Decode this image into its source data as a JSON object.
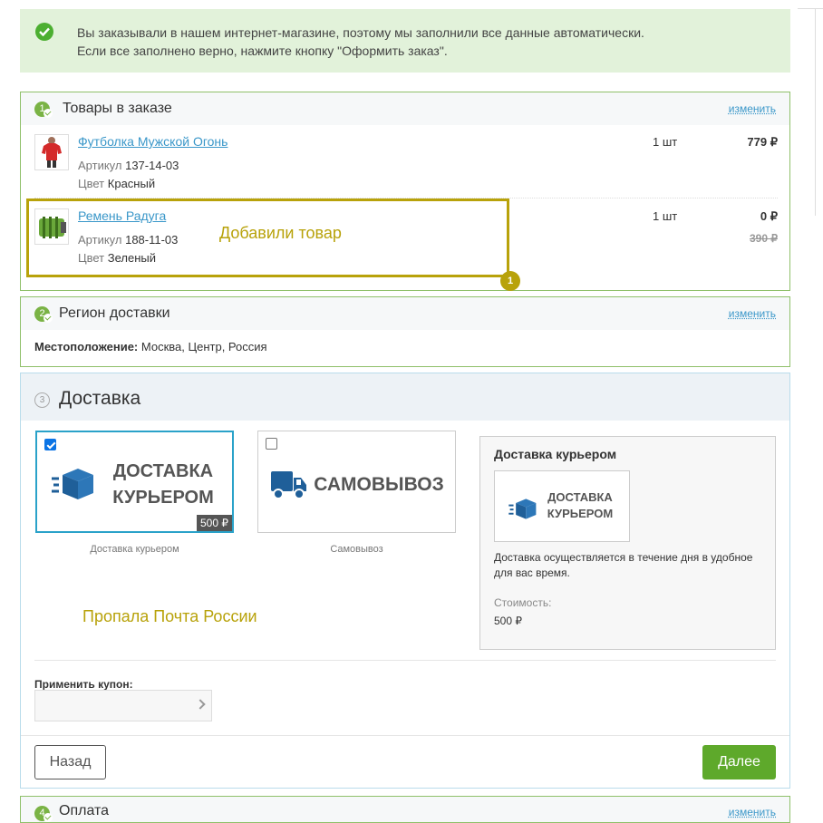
{
  "alert": {
    "line1": "Вы заказывали в нашем интернет-магазине, поэтому мы заполнили все данные автоматически.",
    "line2": "Если все заполнено верно, нажмите кнопку \"Оформить заказ\"."
  },
  "order": {
    "step": "1",
    "title": "Товары в заказе",
    "change": "изменить",
    "items": [
      {
        "name": "Футболка Мужской Огонь",
        "article_label": "Артикул",
        "article": "137-14-03",
        "color_label": "Цвет",
        "color": "Красный",
        "qty": "1 шт",
        "price": "779 ₽",
        "old_price": ""
      },
      {
        "name": "Ремень Радуга",
        "article_label": "Артикул",
        "article": "188-11-03",
        "color_label": "Цвет",
        "color": "Зеленый",
        "qty": "1 шт",
        "price": "0 ₽",
        "old_price": "390 ₽"
      }
    ]
  },
  "annotations": {
    "added": "Добавили товар",
    "badge": "1",
    "missing": "Пропала Почта России"
  },
  "region": {
    "step": "2",
    "title": "Регион доставки",
    "change": "изменить",
    "location_label": "Местоположение:",
    "location": "Москва, Центр, Россия"
  },
  "delivery": {
    "step": "3",
    "title": "Доставка",
    "options": [
      {
        "line1": "ДОСТАВКА",
        "line2": "КУРЬЕРОМ",
        "price": "500 ₽",
        "caption": "Доставка курьером",
        "checked": true
      },
      {
        "line1": "САМОВЫВОЗ",
        "line2": "",
        "price": "",
        "caption": "Самовывоз",
        "checked": false
      }
    ],
    "info": {
      "title": "Доставка курьером",
      "logo_line1": "ДОСТАВКА",
      "logo_line2": "КУРЬЕРОМ",
      "description": "Доставка осуществляется в течение дня в удобное для вас время.",
      "cost_label": "Стоимость:",
      "cost": "500 ₽"
    },
    "coupon_label": "Применить купон:",
    "back": "Назад",
    "next": "Далее"
  },
  "payment": {
    "step": "4",
    "title": "Оплата",
    "change": "изменить"
  },
  "colors": {
    "accent_green": "#5ea92b",
    "link_blue": "#3a97c9",
    "annotation": "#b8a20a",
    "delivery_blue": "#1f5f99"
  }
}
